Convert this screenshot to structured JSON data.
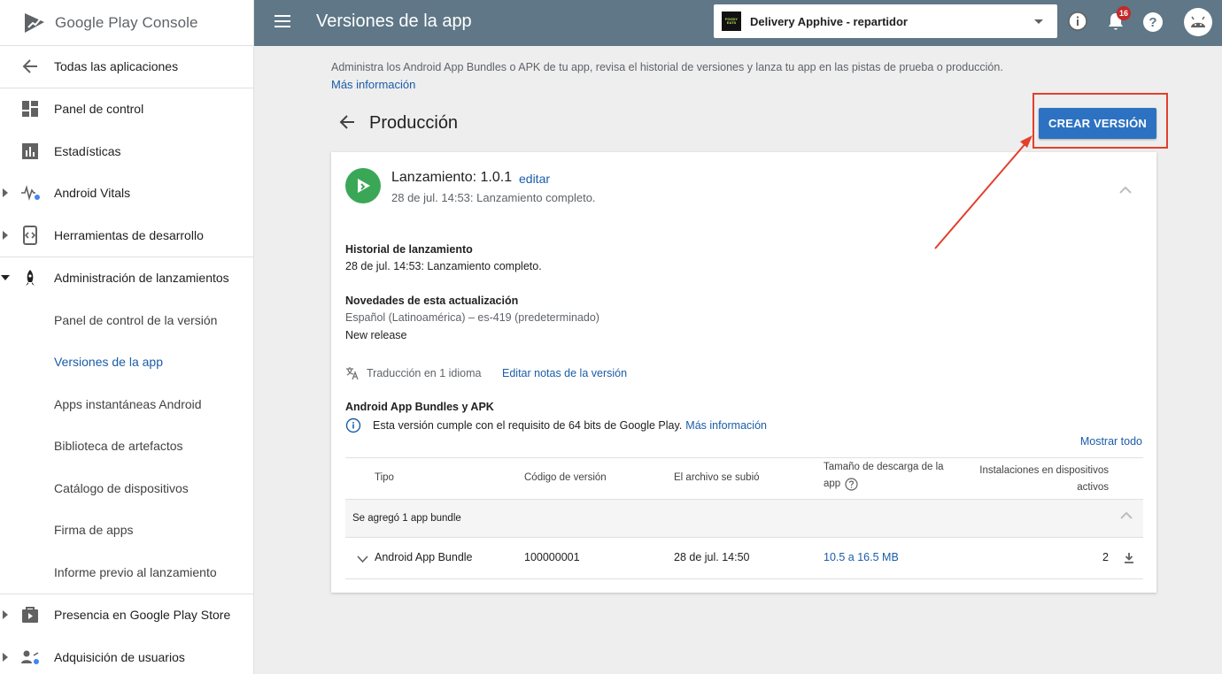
{
  "sidebar": {
    "logo_text": "Google Play Console",
    "back_label": "Todas las aplicaciones",
    "items": [
      {
        "label": "Panel de control"
      },
      {
        "label": "Estadísticas"
      },
      {
        "label": "Android Vitals"
      },
      {
        "label": "Herramientas de desarrollo"
      },
      {
        "label": "Administración de lanzamientos"
      },
      {
        "label": "Panel de control de la versión"
      },
      {
        "label": "Versiones de la app"
      },
      {
        "label": "Apps instantáneas Android"
      },
      {
        "label": "Biblioteca de artefactos"
      },
      {
        "label": "Catálogo de dispositivos"
      },
      {
        "label": "Firma de apps"
      },
      {
        "label": "Informe previo al lanzamiento"
      },
      {
        "label": "Presencia en Google Play Store"
      },
      {
        "label": "Adquisición de usuarios"
      }
    ]
  },
  "header": {
    "title": "Versiones de la app",
    "app_name": "Delivery Apphive - repartidor",
    "app_icon_text": "FOODY EATS",
    "notification_count": "16"
  },
  "main": {
    "description": "Administra los Android App Bundles o APK de tu app, revisa el historial de versiones y lanza tu app en las pistas de prueba o producción.",
    "more_info": "Más información",
    "track_title": "Producción",
    "create_button": "CREAR VERSIÓN"
  },
  "release": {
    "title": "Lanzamiento: 1.0.1",
    "edit": "editar",
    "subtitle": "28 de jul. 14:53: Lanzamiento completo.",
    "history_heading": "Historial de lanzamiento",
    "history_text": "28 de jul. 14:53: Lanzamiento completo.",
    "news_heading": "Novedades de esta actualización",
    "news_language": "Español (Latinoamérica) – es-419 (predeterminado)",
    "news_text": "New release",
    "translation_text": "Traducción en 1 idioma",
    "edit_notes": "Editar notas de la versión",
    "bundles_heading": "Android App Bundles y APK",
    "requirement_text": "Esta versión cumple con el requisito de 64 bits de Google Play.",
    "requirement_link": "Más información",
    "show_all": "Mostrar todo"
  },
  "table": {
    "headers": {
      "type": "Tipo",
      "version_code": "Código de versión",
      "uploaded": "El archivo se subió",
      "size_line1": "Tamaño de descarga de la",
      "size_line2": "app",
      "installs_line1": "Instalaciones en dispositivos",
      "installs_line2": "activos"
    },
    "group_label": "Se agregó 1 app bundle",
    "row": {
      "type": "Android App Bundle",
      "version_code": "100000001",
      "uploaded": "28 de jul. 14:50",
      "size": "10.5 a 16.5 MB",
      "installs": "2"
    }
  }
}
